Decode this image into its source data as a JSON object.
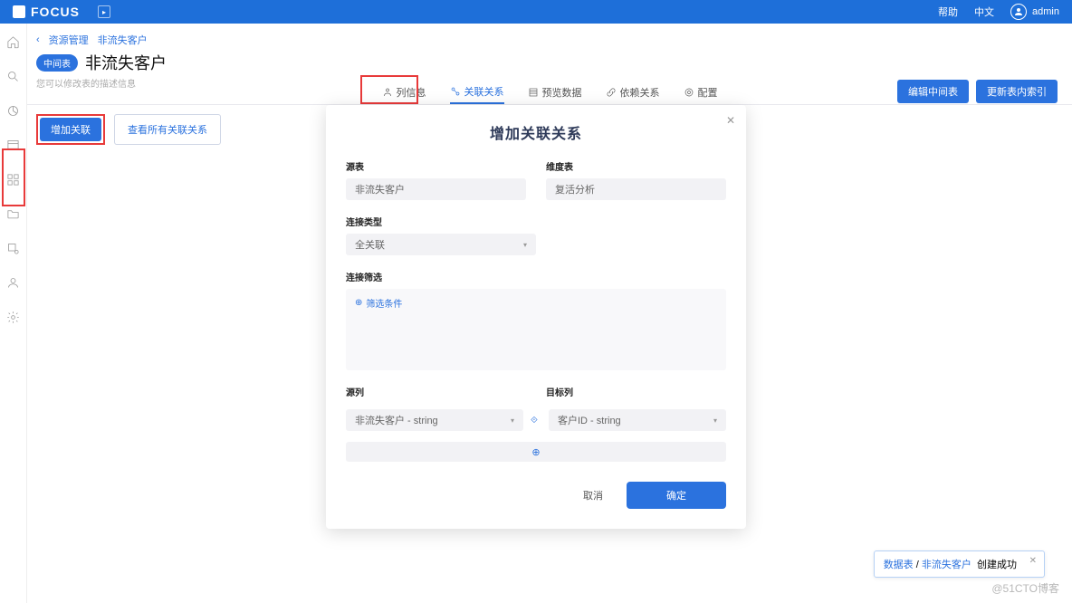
{
  "header": {
    "brand": "FOCUS",
    "help": "帮助",
    "lang": "中文",
    "user": "admin"
  },
  "crumb": {
    "up": "资源管理",
    "current": "非流失客户"
  },
  "page": {
    "badge": "中间表",
    "title": "非流失客户",
    "subtitle": "您可以修改表的描述信息"
  },
  "tabs": {
    "t1": "列信息",
    "t2": "关联关系",
    "t3": "预览数据",
    "t4": "依赖关系",
    "t5": "配置",
    "btn_edit": "编辑中间表",
    "btn_index": "更新表内索引"
  },
  "actions": {
    "add": "增加关联",
    "view": "查看所有关联关系"
  },
  "modal": {
    "title": "增加关联关系",
    "src_label": "源表",
    "src_value": "非流失客户",
    "dim_label": "维度表",
    "dim_value": "复活分析",
    "join_type_label": "连接类型",
    "join_type_value": "全关联",
    "filter_label": "连接筛选",
    "filter_link_text": "筛选条件",
    "src_col_label": "源列",
    "src_col_value": "非流失客户 - string",
    "tgt_col_label": "目标列",
    "tgt_col_value": "客户ID - string",
    "add_icon": "⊕",
    "cancel": "取消",
    "confirm": "确定"
  },
  "toast": {
    "link1": "数据表",
    "sep": "/",
    "link2": "非流失客户",
    "msg": "创建成功"
  },
  "watermark": "@51CTO博客"
}
